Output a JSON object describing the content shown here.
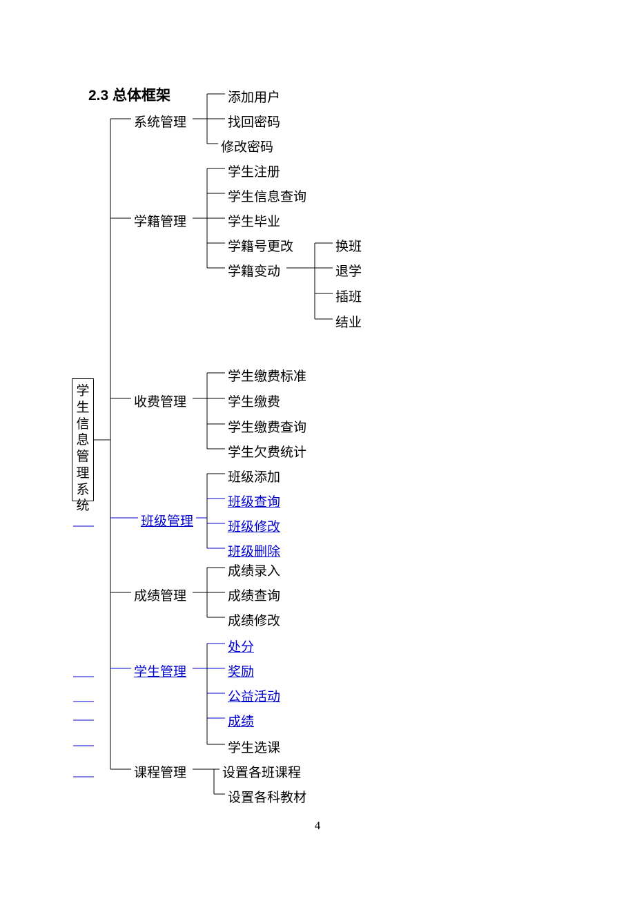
{
  "heading": "2.3 总体框架",
  "page_number": "4",
  "root": "学生信息管理系统",
  "level1": {
    "system_mgmt": "系统管理",
    "enrollment_mgmt": "学籍管理",
    "fee_mgmt": "收费管理",
    "class_mgmt": "班级管理",
    "grade_mgmt": "成绩管理",
    "student_mgmt": "学生管理",
    "course_mgmt": "课程管理"
  },
  "system_mgmt": {
    "add_user": "添加用户",
    "recover_pwd": "找回密码",
    "change_pwd": "修改密码"
  },
  "enrollment_mgmt": {
    "register": "学生注册",
    "query": "学生信息查询",
    "graduate": "学生毕业",
    "change_id": "学籍号更改",
    "change_status": "学籍变动"
  },
  "status_change": {
    "change_class": "换班",
    "dropout": "退学",
    "insert_class": "插班",
    "complete": "结业"
  },
  "fee_mgmt": {
    "standard": "学生缴费标准",
    "pay": "学生缴费",
    "query": "学生缴费查询",
    "arrears": "学生欠费统计"
  },
  "class_mgmt": {
    "add": "班级添加",
    "query": "班级查询",
    "modify": "班级修改",
    "delete": "班级删除"
  },
  "grade_mgmt": {
    "input": "成绩录入",
    "query": "成绩查询",
    "modify": "成绩修改"
  },
  "student_mgmt": {
    "punish": "处分",
    "reward": "奖励",
    "activity": "公益活动",
    "grade": "成绩",
    "select_course": "学生选课"
  },
  "course_mgmt": {
    "set_class_course": "设置各班课程",
    "set_textbook": "设置各科教材"
  }
}
